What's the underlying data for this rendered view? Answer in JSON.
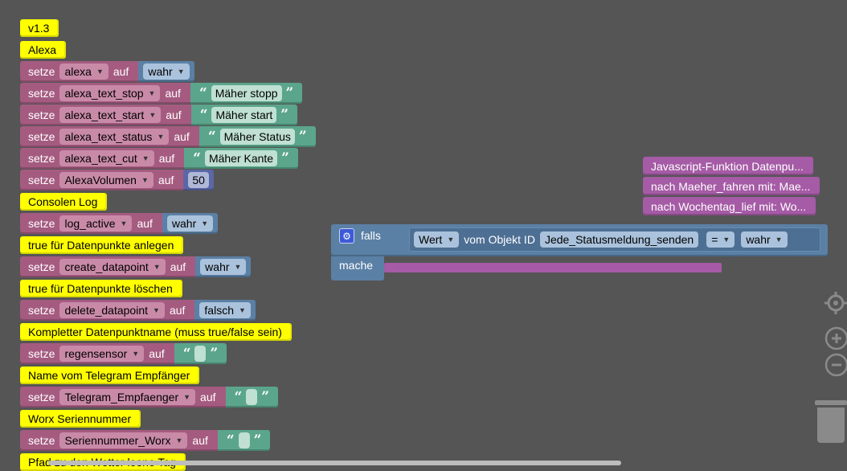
{
  "comments": {
    "c1": "v1.3",
    "c2": "Alexa",
    "c3": "Consolen Log",
    "c4": "true für Datenpunkte anlegen",
    "c5": "true für Datenpunkte löschen",
    "c6": "Kompletter Datenpunktname (muss true/false sein)",
    "c7": "Name vom Telegram Empfänger",
    "c8": "Worx Seriennummer",
    "c9": "Pfad zu den Wetter leone Tag"
  },
  "keywords": {
    "setze": "setze",
    "auf": "auf",
    "falls": "falls",
    "mache": "mache",
    "vom_objekt_id": "vom Objekt ID"
  },
  "setze_blocks": [
    {
      "var": "alexa",
      "value": "wahr",
      "type": "bool"
    },
    {
      "var": "alexa_text_stop",
      "value": "Mäher stopp",
      "type": "string"
    },
    {
      "var": "alexa_text_start",
      "value": "Mäher start",
      "type": "string"
    },
    {
      "var": "alexa_text_status",
      "value": "Mäher Status",
      "type": "string"
    },
    {
      "var": "alexa_text_cut",
      "value": "Mäher Kante",
      "type": "string"
    },
    {
      "var": "AlexaVolumen",
      "value": "50",
      "type": "number"
    },
    {
      "var": "log_active",
      "value": "wahr",
      "type": "bool"
    },
    {
      "var": "create_datapoint",
      "value": "wahr",
      "type": "bool"
    },
    {
      "var": "delete_datapoint",
      "value": "falsch",
      "type": "bool"
    },
    {
      "var": "regensensor",
      "value": "",
      "type": "string"
    },
    {
      "var": "Telegram_Empfaenger",
      "value": "",
      "type": "string"
    },
    {
      "var": "Seriennummer_Worx",
      "value": "",
      "type": "string"
    }
  ],
  "functions": {
    "f1": "Javascript-Funktion Datenpu...",
    "f2": "nach Maeher_fahren mit: Mae...",
    "f3": "nach Wochentag_lief mit: Wo..."
  },
  "if_block": {
    "wert": "Wert",
    "object_id": "Jede_Statusmeldung_senden",
    "operator": "=",
    "compare": "wahr"
  },
  "icons": {
    "gear": "gear-icon",
    "target": "target-icon",
    "zoom_in": "zoom-in-icon",
    "zoom_out": "zoom-out-icon",
    "trash": "trash-icon"
  },
  "colors": {
    "workspace": "#555555",
    "variables": "#a55b80",
    "logic": "#5b80a5",
    "text": "#5ba58c",
    "math": "#5b67a5",
    "procedures": "#a55ba5",
    "comment": "#ffff00"
  }
}
